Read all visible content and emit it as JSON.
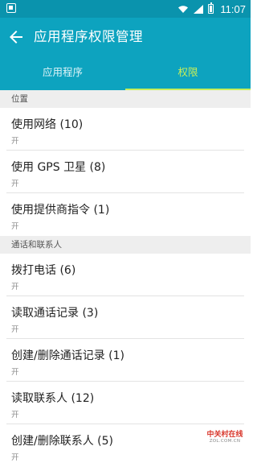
{
  "status_bar": {
    "time": "11:07"
  },
  "header": {
    "title": "应用程序权限管理"
  },
  "tabs": [
    {
      "label": "应用程序",
      "active": false
    },
    {
      "label": "权限",
      "active": true
    }
  ],
  "sections": [
    {
      "header": "位置",
      "items": [
        {
          "title": "使用网络 (10)",
          "status": "开"
        },
        {
          "title": "使用 GPS 卫星 (8)",
          "status": "开"
        },
        {
          "title": "使用提供商指令 (1)",
          "status": "开"
        }
      ]
    },
    {
      "header": "通话和联系人",
      "items": [
        {
          "title": "拨打电话 (6)",
          "status": "开"
        },
        {
          "title": "读取通话记录 (3)",
          "status": "开"
        },
        {
          "title": "创建/删除通话记录 (1)",
          "status": "开"
        },
        {
          "title": "读取联系人 (12)",
          "status": "开"
        },
        {
          "title": "创建/删除联系人 (5)",
          "status": "开"
        }
      ]
    }
  ],
  "watermark": {
    "top": "中关村在线",
    "bottom": "ZOL.COM.CN"
  },
  "colors": {
    "toolbar": "#0da3bf",
    "status_bar": "#0a93ad",
    "tab_active": "#c6ee5a"
  }
}
